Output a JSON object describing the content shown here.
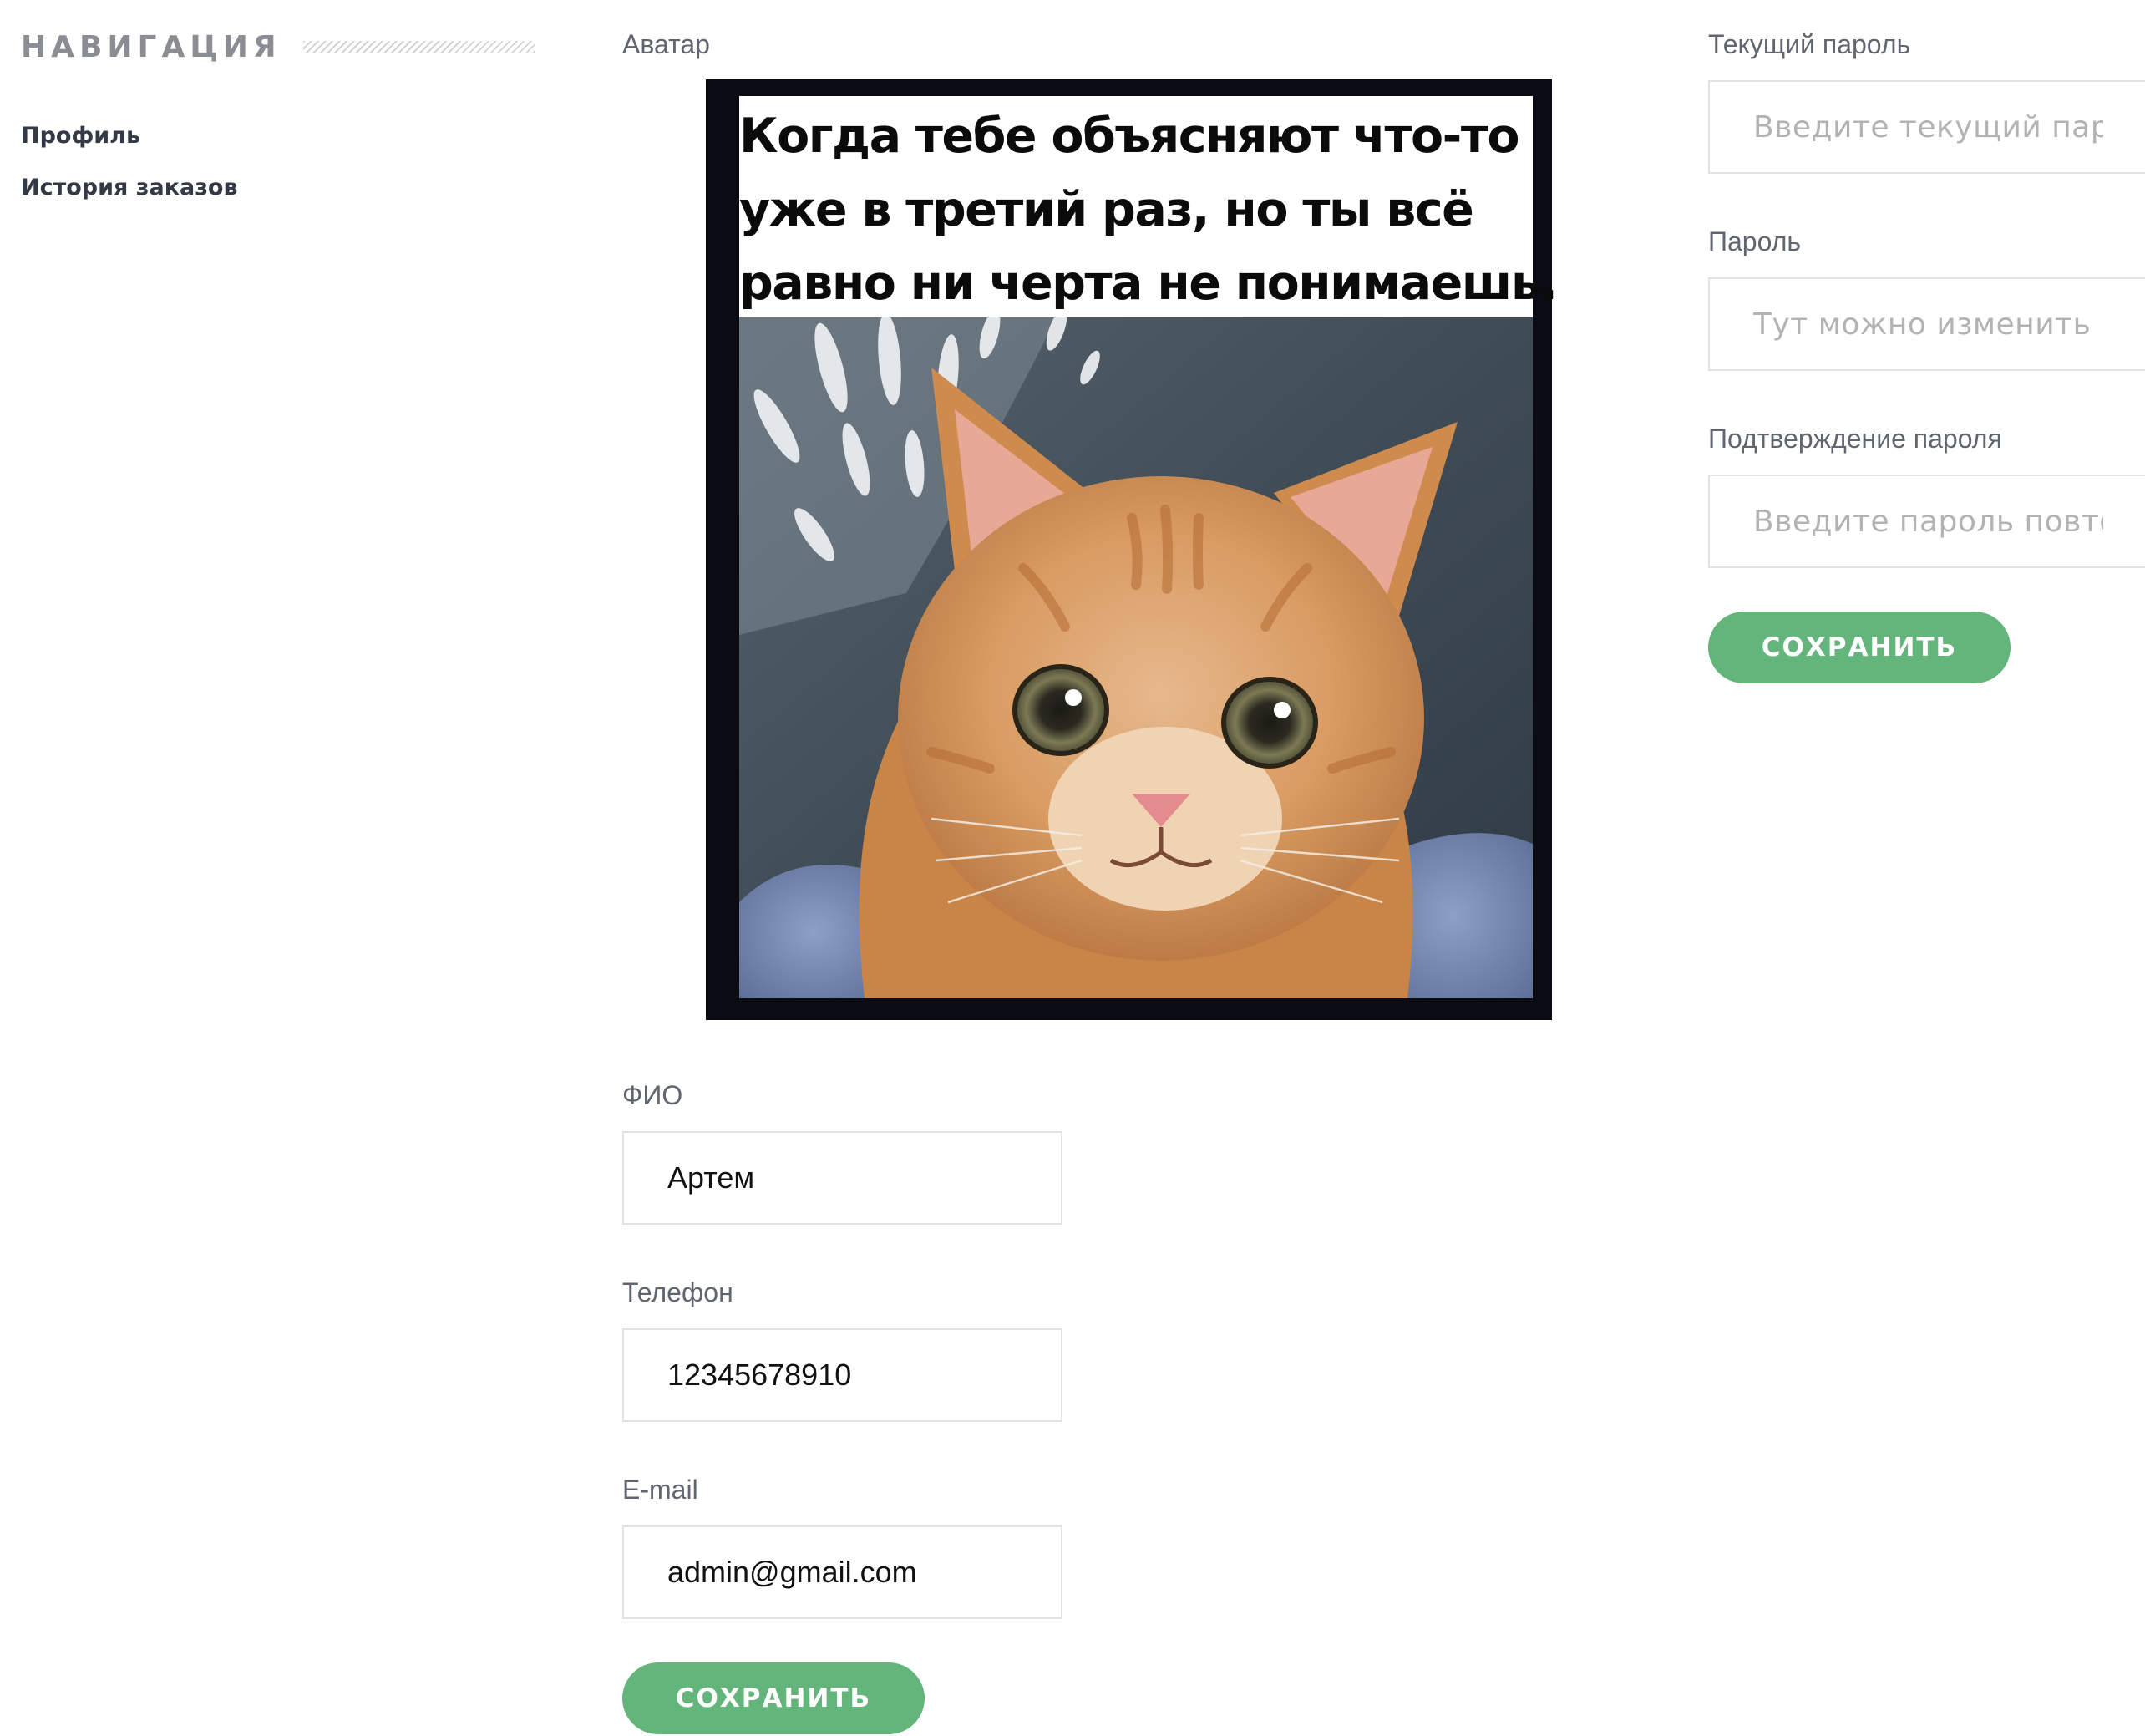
{
  "sidebar": {
    "title": "НАВИГАЦИЯ",
    "items": [
      {
        "label": "Профиль"
      },
      {
        "label": "История заказов"
      }
    ]
  },
  "profile_form": {
    "avatar_label": "Аватар",
    "avatar_image": {
      "caption_lines": [
        "Когда тебе объясняют что-то",
        "уже в третий раз, но ты всё",
        "равно ни черта не понимаешь."
      ],
      "subject": "smiling-ginger-cat"
    },
    "fio": {
      "label": "ФИО",
      "value": "Артем"
    },
    "phone": {
      "label": "Телефон",
      "value": "12345678910"
    },
    "email": {
      "label": "E-mail",
      "value": "admin@gmail.com"
    },
    "save_label": "СОХРАНИТЬ"
  },
  "password_form": {
    "current": {
      "label": "Текущий пароль",
      "placeholder": "Введите текущий пароль"
    },
    "new": {
      "label": "Пароль",
      "placeholder": "Тут можно изменить пароль"
    },
    "confirm": {
      "label": "Подтверждение пароля",
      "placeholder": "Введите пароль повторно"
    },
    "save_label": "СОХРАНИТЬ"
  },
  "colors": {
    "accent": "#63b57b",
    "text": "#333a45",
    "muted": "#5f6670",
    "placeholder": "#b3b3b3",
    "border": "#e2e2e2"
  }
}
